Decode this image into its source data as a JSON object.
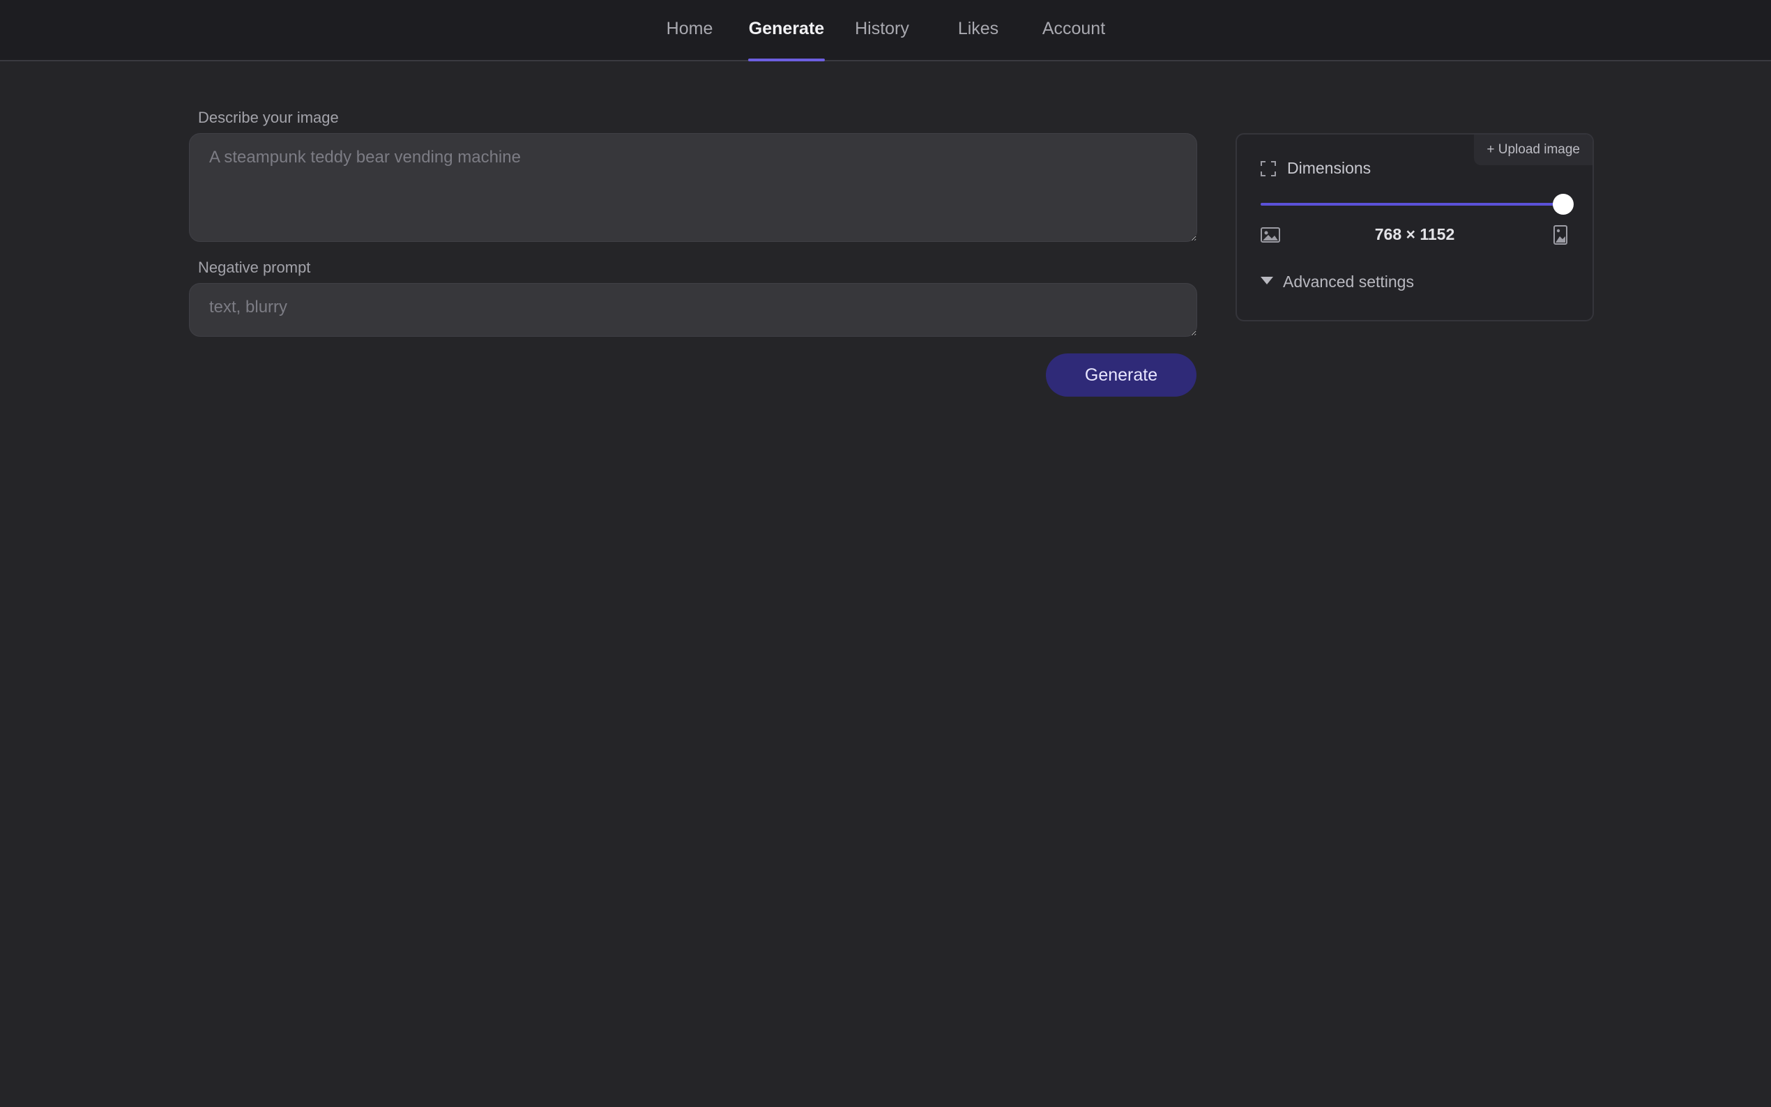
{
  "nav": {
    "items": [
      {
        "label": "Home"
      },
      {
        "label": "Generate"
      },
      {
        "label": "History"
      },
      {
        "label": "Likes"
      },
      {
        "label": "Account"
      }
    ],
    "active": "Generate",
    "accent_color": "#6d5fe0"
  },
  "prompt": {
    "label": "Describe your image",
    "placeholder": "A steampunk teddy bear vending machine",
    "value": ""
  },
  "negative_prompt": {
    "label": "Negative prompt",
    "placeholder": "text, blurry",
    "value": ""
  },
  "generate_button": {
    "label": "Generate",
    "color": "#2f2a78"
  },
  "settings": {
    "upload_label": "+ Upload image",
    "dimensions_label": "Dimensions",
    "dimensions_value": "768 × 1152",
    "slider_fraction": 1.0,
    "slider_color": "#5b51d8",
    "advanced_label": "Advanced settings",
    "icons": {
      "dimensions": "expand-icon",
      "landscape": "landscape-image-icon",
      "portrait": "portrait-image-icon",
      "advanced": "caret-down-icon"
    }
  }
}
